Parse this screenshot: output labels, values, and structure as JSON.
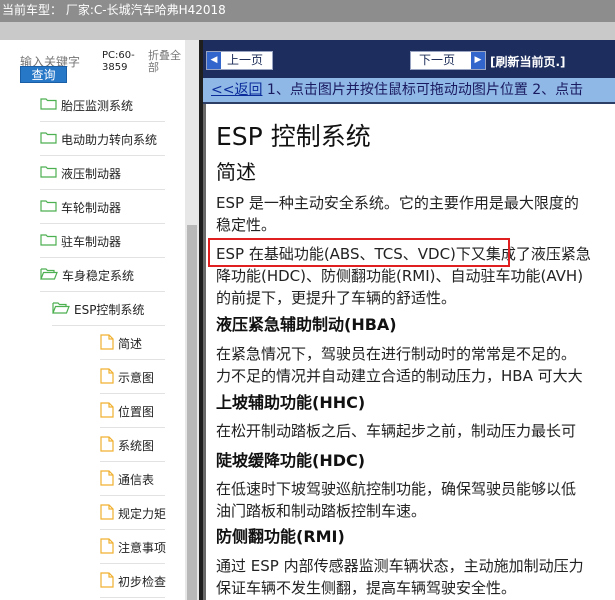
{
  "header": {
    "title": "当前车型：  厂家:C-长城汽车哈弗H42018"
  },
  "sidebar": {
    "search_placeholder": "输入关键字",
    "search_button": "查询",
    "pc_label": "PC:60-3859",
    "collapse_label": "折叠全部",
    "items": [
      {
        "label": "胎压监测系统",
        "icon": "folder-icon"
      },
      {
        "label": "电动助力转向系统",
        "icon": "folder-icon"
      },
      {
        "label": "液压制动器",
        "icon": "folder-icon"
      },
      {
        "label": "车轮制动器",
        "icon": "folder-icon"
      },
      {
        "label": "驻车制动器",
        "icon": "folder-icon"
      },
      {
        "label": "车身稳定系统",
        "icon": "folder-open-icon"
      },
      {
        "label": "ESP控制系统",
        "icon": "folder-open-icon"
      },
      {
        "label": "简述",
        "icon": "document-icon"
      },
      {
        "label": "示意图",
        "icon": "document-icon"
      },
      {
        "label": "位置图",
        "icon": "document-icon"
      },
      {
        "label": "系统图",
        "icon": "document-icon"
      },
      {
        "label": "通信表",
        "icon": "document-icon"
      },
      {
        "label": "规定力矩",
        "icon": "document-icon"
      },
      {
        "label": "注意事项",
        "icon": "document-icon"
      },
      {
        "label": "初步检查",
        "icon": "document-icon"
      }
    ]
  },
  "toolbar": {
    "prev_label": "上一页",
    "next_label": "下一页",
    "refresh_label": "[刷新当前页.]"
  },
  "marquee": {
    "back_label": "<<返回",
    "text": "1、点击图片并按住鼠标可拖动动图片位置 2、点击"
  },
  "content": {
    "title": "ESP 控制系统",
    "subtitle": "简述",
    "p1_line1": "ESP 是一种主动安全系统。它的主要作用是最大限度的",
    "p1_line2": "稳定性。",
    "p2_line1": "ESP 在基础功能(ABS、TCS、VDC)下又集成了液压紧急",
    "p2_line2": "降功能(HDC)、防侧翻功能(RMI)、自动驻车功能(AVH)",
    "p2_line3": "的前提下，更提升了车辆的舒适性。",
    "h_hba": "液压紧急辅助制动(HBA)",
    "hba_line1": "在紧急情况下，驾驶员在进行制动时的常常是不足的。",
    "hba_line2": "力不足的情况并自动建立合适的制动压力，HBA 可大大",
    "h_hhc": "上坡辅助功能(HHC)",
    "hhc_line1": "在松开制动踏板之后、车辆起步之前，制动压力最长可",
    "h_hdc": "陡坡缓降功能(HDC)",
    "hdc_line1": "在低速时下坡驾驶巡航控制功能，确保驾驶员能够以低",
    "hdc_line2": "油门踏板和制动踏板控制车速。",
    "h_rmi": "防侧翻功能(RMI)",
    "rmi_line1": "通过 ESP 内部传感器监测车辆状态，主动施加制动压力",
    "rmi_line2": "保证车辆不发生侧翻，提高车辆驾驶安全性。"
  },
  "colors": {
    "header_bg": "#8d8d8d",
    "nav_bg": "#1c2d5e",
    "marquee_bg": "#8fb8e6",
    "highlight": "#e02020",
    "folder": "#4caf50",
    "document": "#f0b030"
  }
}
